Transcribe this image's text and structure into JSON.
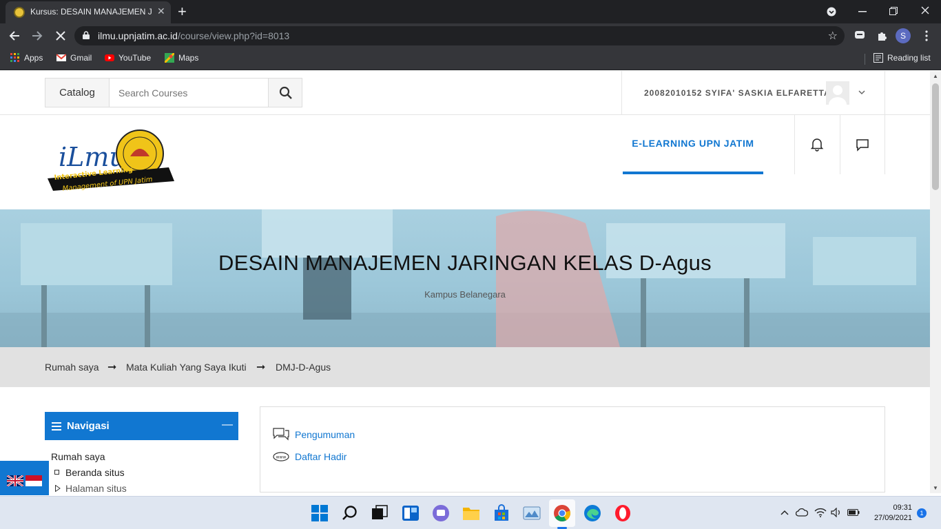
{
  "browser": {
    "tab_title": "Kursus: DESAIN MANAJEMEN JA",
    "tab_close": "✕",
    "new_tab": "+",
    "url_domain": "ilmu.upnjatim.ac.id",
    "url_path": "/course/view.php?id=8013",
    "profile_initial": "S",
    "bookmarks": [
      "Apps",
      "Gmail",
      "YouTube",
      "Maps"
    ],
    "reading_list": "Reading list"
  },
  "topbar": {
    "catalog_label": "Catalog",
    "search_placeholder": "Search Courses",
    "user_name": "20082010152 SYIFA' SASKIA ELFARETTA"
  },
  "header": {
    "nav_label": "E-LEARNING UPN JATIM",
    "logo_texts": [
      "iLmu",
      "Interactive Learning",
      "Management of UPN Jatim"
    ]
  },
  "hero": {
    "title": "DESAIN MANAJEMEN JARINGAN KELAS D-Agus",
    "subtitle": "Kampus Belanegara"
  },
  "breadcrumb": [
    "Rumah saya",
    "Mata Kuliah Yang Saya Ikuti",
    "DMJ-D-Agus"
  ],
  "navigation": {
    "title": "Navigasi",
    "collapse": "—",
    "items": [
      "Rumah saya",
      "Beranda situs",
      "Halaman situs"
    ]
  },
  "activities": [
    "Pengumuman",
    "Daftar Hadir"
  ],
  "taskbar": {
    "time": "09:31",
    "date": "27/09/2021",
    "notifications": "1"
  },
  "colors": {
    "accent": "#1177d1",
    "chrome_dark": "#202124",
    "chrome_toolbar": "#35363a"
  }
}
